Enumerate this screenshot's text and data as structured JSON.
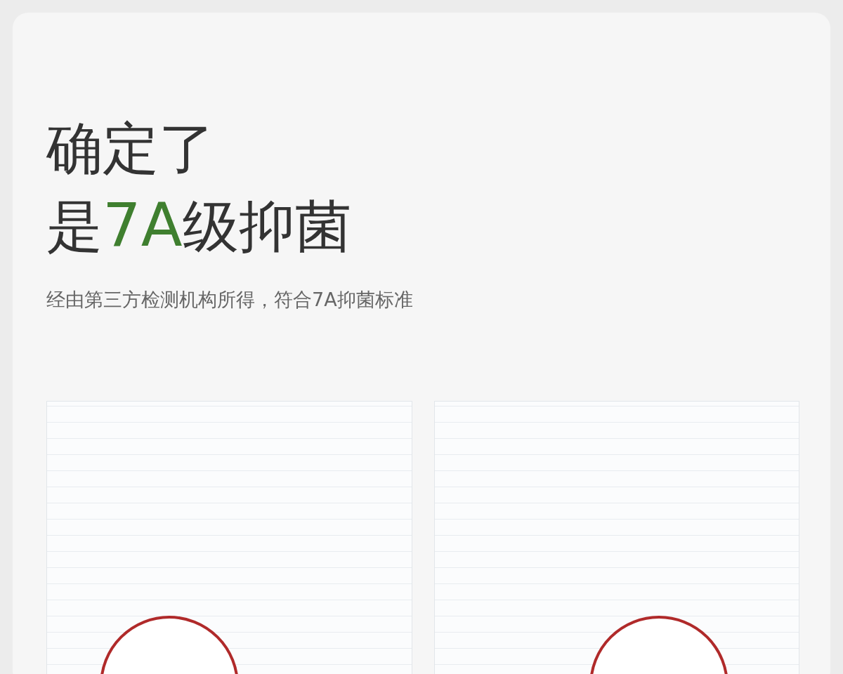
{
  "headline": {
    "line_1": "确定了",
    "line_2": [
      {
        "text": "是",
        "highlight": false
      },
      {
        "text": "7A",
        "highlight": true
      },
      {
        "text": "级抑菌",
        "highlight": false
      }
    ]
  },
  "subtitle": "经由第三方检测机构所得，符合7A抑菌标准",
  "documents": [
    {
      "kind": "photo"
    },
    {
      "kind": "photo"
    }
  ]
}
